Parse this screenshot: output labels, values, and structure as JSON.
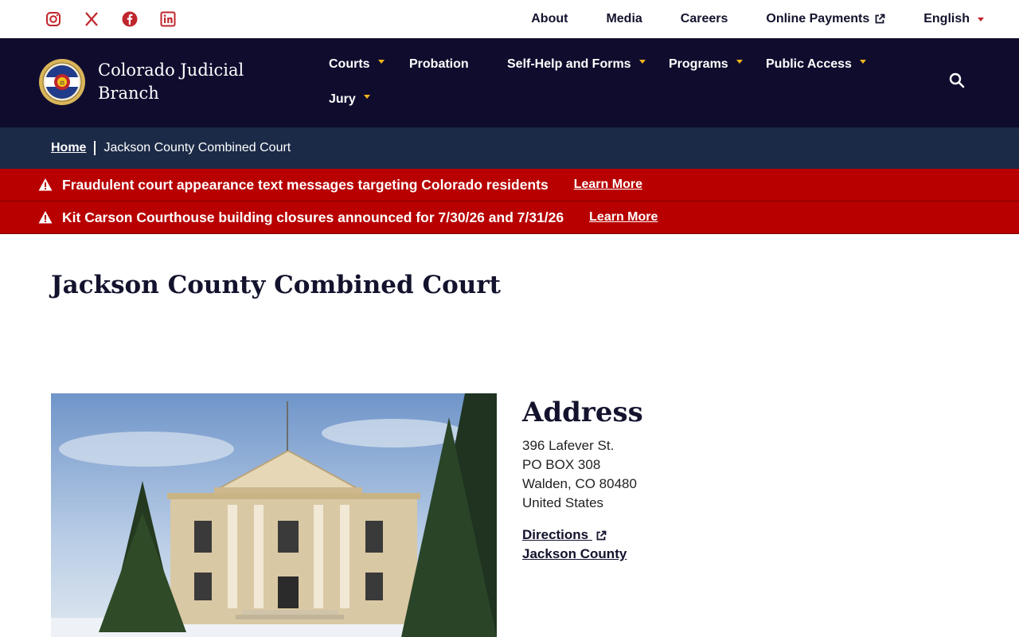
{
  "utility_bar": {
    "social": [
      {
        "name": "instagram-icon"
      },
      {
        "name": "x-icon"
      },
      {
        "name": "facebook-icon"
      },
      {
        "name": "linkedin-icon"
      }
    ],
    "links": {
      "about": "About",
      "media": "Media",
      "careers": "Careers",
      "online_payments": "Online Payments",
      "language": "English"
    }
  },
  "header": {
    "brand_line1": "Colorado Judicial",
    "brand_line2": "Branch",
    "nav": {
      "courts": "Courts",
      "probation": "Probation",
      "self_help": "Self-Help and Forms",
      "programs": "Programs",
      "public_access": "Public Access",
      "jury": "Jury"
    }
  },
  "breadcrumb": {
    "home": "Home",
    "current": "Jackson County Combined Court"
  },
  "alerts": [
    {
      "message": "Fraudulent court appearance text messages targeting Colorado residents",
      "link": "Learn More"
    },
    {
      "message": "Kit Carson Courthouse building closures announced for 7/30/26 and 7/31/26",
      "link": "Learn More"
    }
  ],
  "main": {
    "title": "Jackson County Combined Court",
    "address": {
      "heading": "Address",
      "line1": "396 Lafever St.",
      "line2": "PO BOX 308",
      "line3": "Walden, CO 80480",
      "line4": "United States",
      "directions": "Directions",
      "county": "Jackson County"
    }
  },
  "colors": {
    "navy": "#0f0c2e",
    "breadcrumb_bg": "#1b2a47",
    "alert_red": "#b80000",
    "social_red": "#c0262d",
    "gold": "#f2b51c"
  }
}
